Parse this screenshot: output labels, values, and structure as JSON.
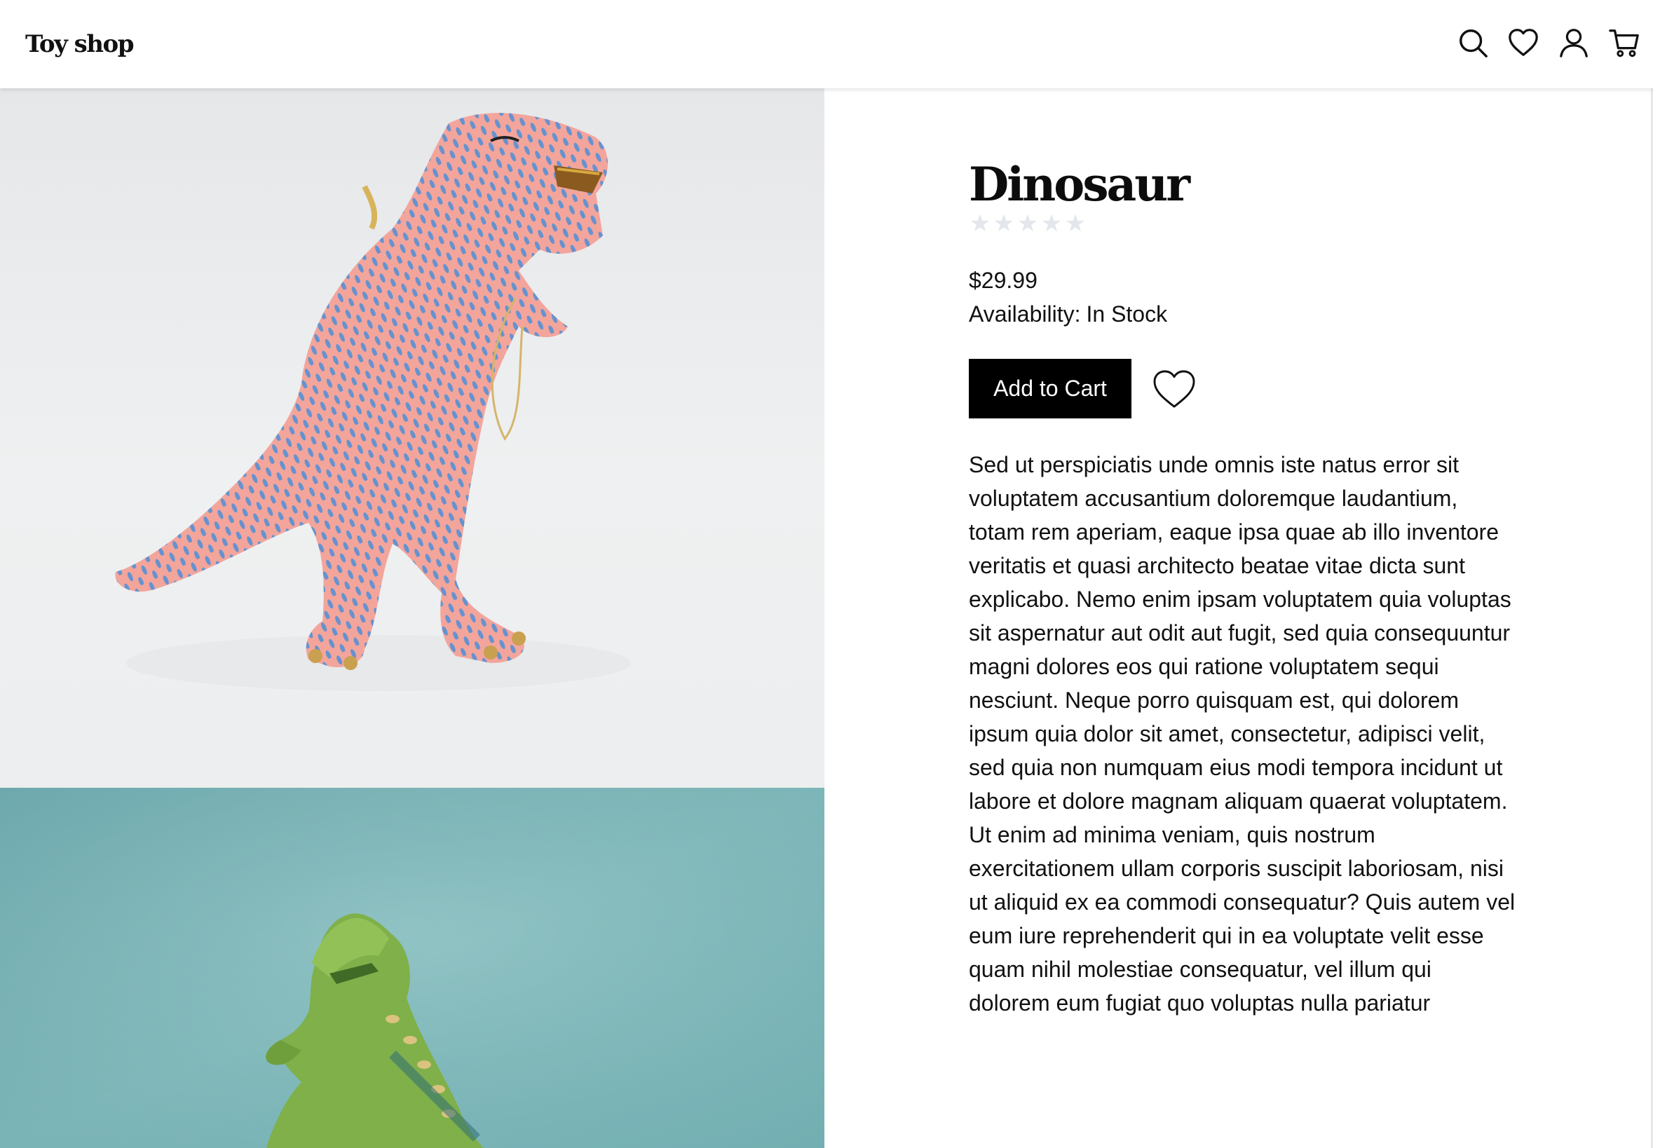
{
  "header": {
    "logo": "Toy shop",
    "icons": [
      "search-icon",
      "heart-icon",
      "user-icon",
      "cart-icon"
    ]
  },
  "gallery": {
    "images": [
      {
        "subject": "pink dinosaur figurine with blue spots",
        "background": "#eceef0"
      },
      {
        "subject": "green toy dinosaur",
        "background": "#7fb7ba"
      }
    ]
  },
  "product": {
    "title": "Dinosaur",
    "rating": {
      "stars_total": 5,
      "stars_filled": 0,
      "star_color": "#e3e6ea"
    },
    "price": "$29.99",
    "availability_label": "Availability:",
    "availability_value": "In Stock",
    "add_to_cart_label": "Add to Cart",
    "description": "Sed ut perspiciatis unde omnis iste natus error sit voluptatem accusantium doloremque laudantium, totam rem aperiam, eaque ipsa quae ab illo inventore veritatis et quasi architecto beatae vitae dicta sunt explicabo. Nemo enim ipsam voluptatem quia voluptas sit aspernatur aut odit aut fugit, sed quia consequuntur magni dolores eos qui ratione voluptatem sequi nesciunt. Neque porro quisquam est, qui dolorem ipsum quia dolor sit amet, consectetur, adipisci velit, sed quia non numquam eius modi tempora incidunt ut labore et dolore magnam aliquam quaerat voluptatem. Ut enim ad minima veniam, quis nostrum exercitationem ullam corporis suscipit laboriosam, nisi ut aliquid ex ea commodi consequatur? Quis autem vel eum iure reprehenderit qui in ea voluptate velit esse quam nihil molestiae consequatur, vel illum qui dolorem eum fugiat quo voluptas nulla pariatur"
  },
  "colors": {
    "button_bg": "#000000",
    "button_text": "#ffffff",
    "text": "#111111"
  }
}
